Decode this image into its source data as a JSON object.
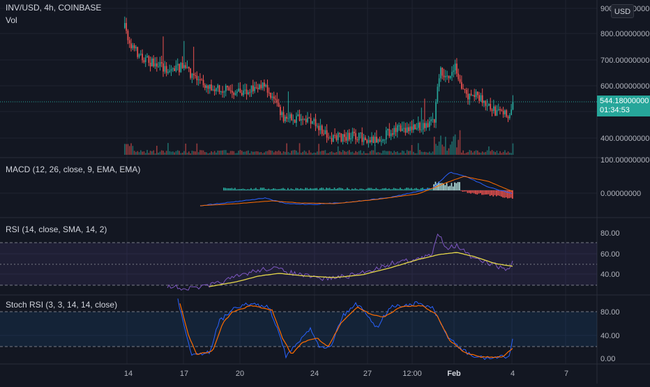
{
  "header": {
    "symbol_title": "INV/USD, 4h, COINBASE",
    "volume_label": "Vol",
    "currency_button": "USD"
  },
  "price_axis": {
    "ticks": [
      "900.00000000",
      "800.00000000",
      "700.00000000",
      "600.00000000",
      "400.00000000"
    ],
    "last_price": "544.18000000",
    "countdown": "01:34:53"
  },
  "macd": {
    "title": "MACD (12, 26, close, 9, EMA, EMA)",
    "ticks": [
      "100.00000000",
      "0.00000000"
    ]
  },
  "rsi": {
    "title": "RSI (14, close, SMA, 14, 2)",
    "ticks": [
      "80.00",
      "60.00",
      "40.00"
    ]
  },
  "stoch": {
    "title": "Stoch RSI (3, 3, 14, 14, close)",
    "ticks": [
      "80.00",
      "40.00",
      "0.00"
    ]
  },
  "time_axis": {
    "labels": [
      "14",
      "17",
      "20",
      "24",
      "27",
      "12:00",
      "Feb",
      "4",
      "7"
    ]
  },
  "colors": {
    "background": "#131722",
    "bull": "#26a69a",
    "bear": "#ef5350",
    "macd_line": "#2962ff",
    "signal_line": "#ff6d00",
    "rsi_line": "#7e57c2",
    "rsi_ma": "#e6d84a",
    "stoch_k": "#2962ff",
    "stoch_d": "#ff6d00",
    "rsi_band": "#7e57c2",
    "stoch_band": "#2196f3"
  }
}
